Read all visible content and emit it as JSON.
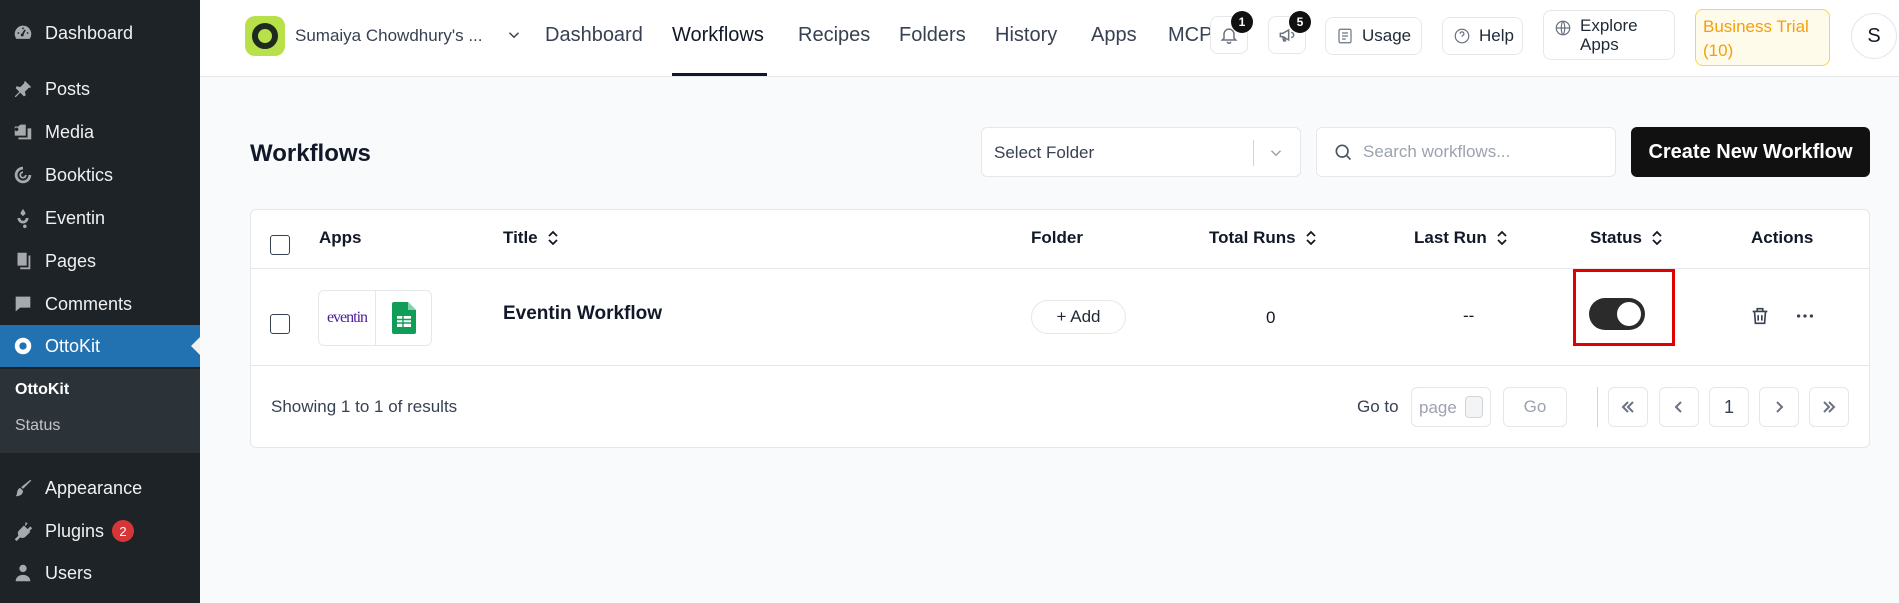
{
  "sidebar": {
    "items": [
      {
        "label": "Dashboard",
        "icon": "dashboard-icon"
      },
      {
        "label": "Posts",
        "icon": "pin-icon"
      },
      {
        "label": "Media",
        "icon": "media-icon"
      },
      {
        "label": "Booktics",
        "icon": "booktics-icon"
      },
      {
        "label": "Eventin",
        "icon": "eventin-icon"
      },
      {
        "label": "Pages",
        "icon": "pages-icon"
      },
      {
        "label": "Comments",
        "icon": "comment-icon"
      },
      {
        "label": "OttoKit",
        "icon": "ottokit-icon"
      },
      {
        "label": "Appearance",
        "icon": "brush-icon"
      },
      {
        "label": "Plugins",
        "icon": "plug-icon",
        "badge": "2"
      },
      {
        "label": "Users",
        "icon": "user-icon"
      }
    ],
    "submenu": [
      "OttoKit",
      "Status"
    ],
    "active_color": "#2271b1",
    "background_color": "#1d2327"
  },
  "topbar": {
    "site_name": "Sumaiya Chowdhury's ...",
    "nav": [
      "Dashboard",
      "Workflows",
      "Recipes",
      "Folders",
      "History",
      "Apps",
      "MCP"
    ],
    "active_nav": "Workflows",
    "notifications_count": "1",
    "announcements_count": "5",
    "usage_label": "Usage",
    "help_label": "Help",
    "explore_label_1": "Explore",
    "explore_label_2": "Apps",
    "trial_label_1": "Business Trial",
    "trial_label_2": "(10)",
    "avatar_initial": "S"
  },
  "main": {
    "title": "Workflows",
    "folder_select_label": "Select Folder",
    "search_placeholder": "Search workflows...",
    "create_button": "Create New Workflow",
    "columns": [
      "Apps",
      "Title",
      "Folder",
      "Total Runs",
      "Last Run",
      "Status",
      "Actions"
    ],
    "rows": [
      {
        "apps": [
          "eventin",
          "google-sheets"
        ],
        "eventin_logo_text": "eventin",
        "title": "Eventin Workflow",
        "folder_action": "+ Add",
        "total_runs": "0",
        "last_run": "--",
        "status_on": true
      }
    ],
    "showing": "Showing 1 to 1 of results",
    "goto_label": "Go to",
    "page_placeholder": "page",
    "go_button": "Go",
    "current_page": "1",
    "highlight_color": "#e00000"
  }
}
